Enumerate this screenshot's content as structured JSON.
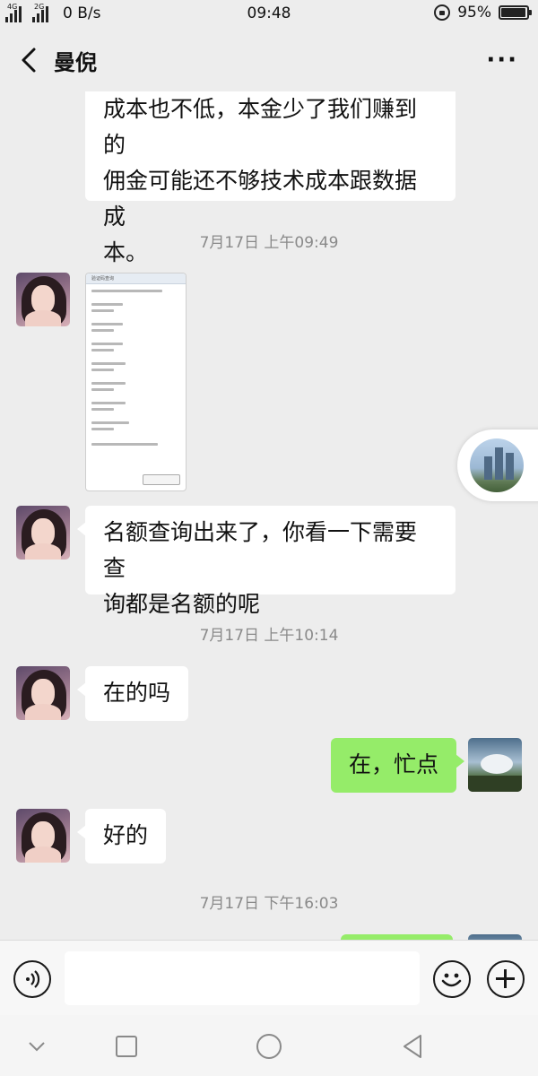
{
  "status": {
    "net1": "4G",
    "net2": "2G",
    "speed": "0 B/s",
    "time": "09:48",
    "battery": "95%",
    "battery_level": 0.95
  },
  "header": {
    "title": "曼倪",
    "back_icon": "chevron-left-icon",
    "more_label": "···"
  },
  "messages": {
    "m1": {
      "line1": "成本也不低，本金少了我们赚到的",
      "line2": "佣金可能还不够技术成本跟数据成",
      "line3": "本。"
    },
    "ts1": "7月17日 上午09:49",
    "img_hdr": "验证码查询",
    "m3": {
      "line1": "名额查询出来了，你看一下需要查",
      "line2": "询都是名额的呢"
    },
    "ts2": "7月17日 上午10:14",
    "m4": "在的吗",
    "m5": "在，忙点",
    "m6": "好的",
    "ts3": "7月17日 下午16:03"
  },
  "input": {
    "value": "",
    "voice_icon": "voice-icon",
    "emoji_icon": "emoji-icon",
    "plus_icon": "plus-icon"
  },
  "nav": {
    "down_icon": "chevron-down-icon",
    "recents_icon": "square-icon",
    "home_icon": "circle-icon",
    "back_icon": "triangle-back-icon"
  },
  "colors": {
    "me_bubble": "#95ec69",
    "other_bubble": "#ffffff",
    "background": "#ededed"
  }
}
